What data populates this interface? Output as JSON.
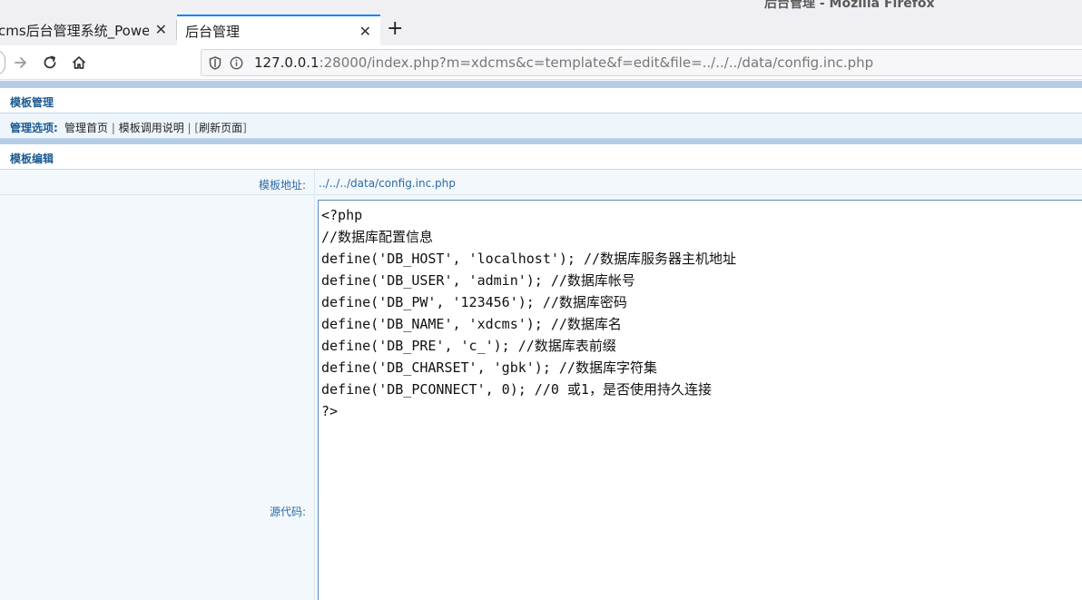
{
  "window": {
    "title": "后台管理 - Mozilla Firefox"
  },
  "tabs": [
    {
      "label": "cms后台管理系统_Power",
      "close": "✕"
    },
    {
      "label": "后台管理",
      "close": "✕"
    }
  ],
  "new_tab": "+",
  "icons": {
    "back": "back-arrow-icon",
    "forward": "forward-arrow-icon",
    "reload": "reload-icon",
    "home": "home-icon",
    "shield": "tracking-shield-icon",
    "info": "site-info-icon"
  },
  "urlbar": {
    "host": "127.0.0.1",
    "rest": ":28000/index.php?m=xdcms&c=template&f=edit&file=../../../data/config.inc.php"
  },
  "page": {
    "section1_title": "模板管理",
    "options_label": "管理选项:",
    "options": {
      "home": "管理首页",
      "sep1": " | ",
      "help": "模板调用说明",
      "sep2": " | [",
      "refresh": "刷新页面",
      "end": "]"
    },
    "section2_title": "模板编辑",
    "addr_label": "模板地址:",
    "addr_value": "../../../data/config.inc.php",
    "code_label": "源代码:",
    "code": "<?php\n//数据库配置信息\ndefine('DB_HOST', 'localhost'); //数据库服务器主机地址\ndefine('DB_USER', 'admin'); //数据库帐号\ndefine('DB_PW', '123456'); //数据库密码\ndefine('DB_NAME', 'xdcms'); //数据库名\ndefine('DB_PRE', 'c_'); //数据库表前缀\ndefine('DB_CHARSET', 'gbk'); //数据库字符集\ndefine('DB_PCONNECT', 0); //0 或1，是否使用持久连接\n?>"
  }
}
